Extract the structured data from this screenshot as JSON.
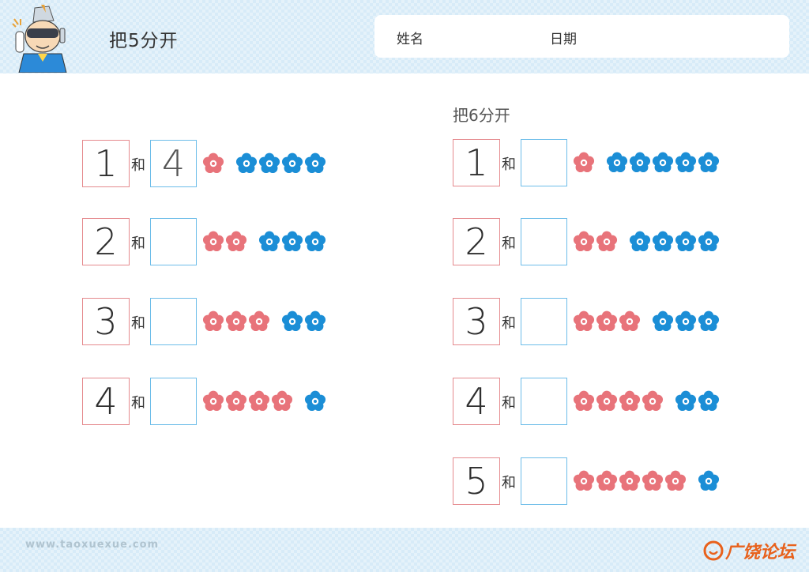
{
  "header": {
    "title": "把5分开",
    "name_label": "姓名",
    "date_label": "日期"
  },
  "left": {
    "rows": [
      {
        "number": "1",
        "connector": "和",
        "answer": "4",
        "red": 1,
        "blue": 4
      },
      {
        "number": "2",
        "connector": "和",
        "answer": "",
        "red": 2,
        "blue": 3
      },
      {
        "number": "3",
        "connector": "和",
        "answer": "",
        "red": 3,
        "blue": 2
      },
      {
        "number": "4",
        "connector": "和",
        "answer": "",
        "red": 4,
        "blue": 1
      }
    ]
  },
  "right": {
    "title": "把6分开",
    "rows": [
      {
        "number": "1",
        "connector": "和",
        "answer": "",
        "red": 1,
        "blue": 5
      },
      {
        "number": "2",
        "connector": "和",
        "answer": "",
        "red": 2,
        "blue": 4
      },
      {
        "number": "3",
        "connector": "和",
        "answer": "",
        "red": 3,
        "blue": 3
      },
      {
        "number": "4",
        "connector": "和",
        "answer": "",
        "red": 4,
        "blue": 2
      },
      {
        "number": "5",
        "connector": "和",
        "answer": "",
        "red": 5,
        "blue": 1
      }
    ]
  },
  "footer": {
    "url": "www.taoxuexue.com",
    "logo_text": "广饶论坛"
  },
  "colors": {
    "red_flower": "#e8737a",
    "blue_flower": "#1b8ed6",
    "num_border": "#e58a8e",
    "answer_border": "#6dbde9"
  },
  "icons": {
    "mascot": "robot-mascot-icon",
    "flower": "flower-icon"
  }
}
